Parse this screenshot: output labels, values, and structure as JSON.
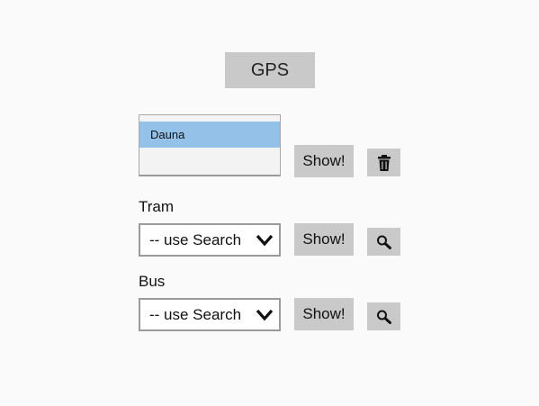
{
  "gps": {
    "label": "GPS"
  },
  "gps_section": {
    "list_items": [
      "Dauna"
    ],
    "selected_item": "Dauna",
    "show_label": "Show!",
    "delete_icon": "trash-icon"
  },
  "tram": {
    "label": "Tram",
    "select_value": "-- use Search",
    "show_label": "Show!",
    "search_icon": "magnifier-icon"
  },
  "bus": {
    "label": "Bus",
    "select_value": "-- use Search",
    "show_label": "Show!",
    "search_icon": "magnifier-icon"
  },
  "colors": {
    "background": "#fafafa",
    "button": "#c9c9c9",
    "selection": "#93c1e8"
  }
}
